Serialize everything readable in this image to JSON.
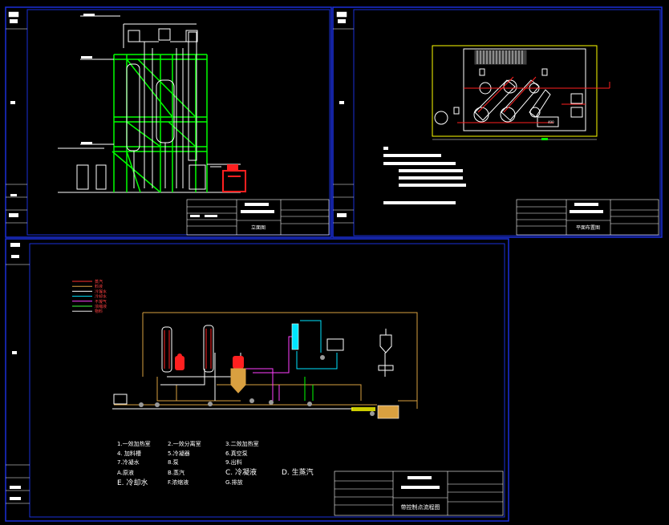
{
  "sheets": {
    "elevation": {
      "title_block": {
        "title": "立面图"
      }
    },
    "plan": {
      "title_block": {
        "title": "平面布置图"
      },
      "scale_mark": "400",
      "notes": [
        "注",
        "1、...",
        "2、..."
      ]
    },
    "flow": {
      "legend": {
        "items": [
          {
            "label": "蒸汽",
            "color": "#ff3030"
          },
          {
            "label": "料液",
            "color": "#d9a040"
          },
          {
            "label": "冷凝水",
            "color": "#ffffff"
          },
          {
            "label": "冷却水",
            "color": "#00e5ff"
          },
          {
            "label": "不凝气",
            "color": "#ff40ff"
          },
          {
            "label": "浓缩液",
            "color": "#40ff40"
          },
          {
            "label": "物料",
            "color": "#e8e8e8"
          }
        ]
      },
      "bottom_labels": {
        "row1": [
          "1.一效加热室",
          "2.一效分离室",
          "3.二效加热室"
        ],
        "row2": [
          "4. 加料槽",
          "5.冷凝器",
          "6.真空泵"
        ],
        "row3": [
          "7.冷凝水",
          "8.泵",
          "9.出料"
        ],
        "row4_left": "A.原液",
        "row4_mid": "B.蒸汽",
        "row4_c": "C. 冷凝液",
        "row4_d": "D. 生蒸汽",
        "row5_left": "E. 冷却水",
        "row5_mid": "F.浓缩液",
        "row5_right": "G.排放"
      },
      "title_block": {
        "title": "带控制点流程图"
      }
    }
  },
  "colors": {
    "frame": "#1a2fd8",
    "steel": "#00ff00",
    "line": "#ffffff",
    "steam": "#ff2020",
    "liquid": "#d9a040",
    "water": "#00e5ff",
    "gas": "#ff40ff",
    "pipe_yellow": "#ffff00"
  }
}
